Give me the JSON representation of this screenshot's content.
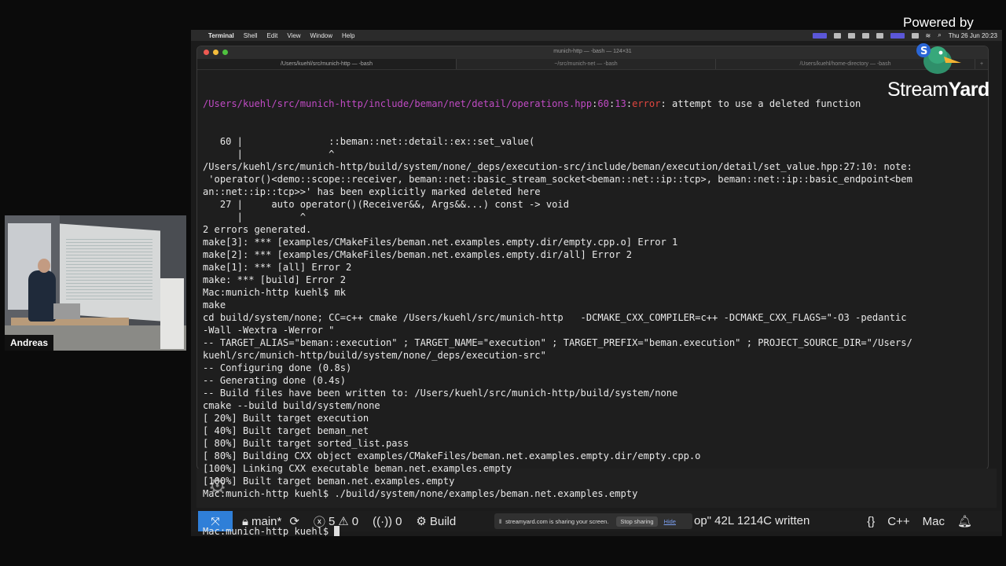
{
  "menubar": {
    "items": [
      "Terminal",
      "Shell",
      "Edit",
      "View",
      "Window",
      "Help"
    ],
    "datetime": "Thu 26 Jun  20:23"
  },
  "terminal": {
    "title": "munich-http — -bash — 124×31",
    "tabs": [
      "/Users/kuehl/src/munich-http — -bash",
      "~/src/munich-net — -bash",
      "/Users/kuehl/home-directory — -bash"
    ],
    "first_line": {
      "path": "/Users/kuehl/src/munich-http/include/beman/net/detail/operations.hpp",
      "line": "60",
      "col": "13",
      "kind": "error",
      "message": ": attempt to use a deleted function"
    },
    "lines": [
      "   60 |               ::beman::net::detail::ex::set_value(",
      "      |               ^",
      "/Users/kuehl/src/munich-http/build/system/none/_deps/execution-src/include/beman/execution/detail/set_value.hpp:27:10: note:",
      " 'operator()<demo::scope::receiver, beman::net::basic_stream_socket<beman::net::ip::tcp>, beman::net::ip::basic_endpoint<bem",
      "an::net::ip::tcp>>' has been explicitly marked deleted here",
      "   27 |     auto operator()(Receiver&&, Args&&...) const -> void",
      "      |          ^",
      "2 errors generated.",
      "make[3]: *** [examples/CMakeFiles/beman.net.examples.empty.dir/empty.cpp.o] Error 1",
      "make[2]: *** [examples/CMakeFiles/beman.net.examples.empty.dir/all] Error 2",
      "make[1]: *** [all] Error 2",
      "make: *** [build] Error 2",
      "Mac:munich-http kuehl$ mk",
      "make",
      "cd build/system/none; CC=c++ cmake /Users/kuehl/src/munich-http   -DCMAKE_CXX_COMPILER=c++ -DCMAKE_CXX_FLAGS=\"-O3 -pedantic",
      "-Wall -Wextra -Werror \"",
      "-- TARGET_ALIAS=\"beman::execution\" ; TARGET_NAME=\"execution\" ; TARGET_PREFIX=\"beman.execution\" ; PROJECT_SOURCE_DIR=\"/Users/",
      "kuehl/src/munich-http/build/system/none/_deps/execution-src\"",
      "-- Configuring done (0.8s)",
      "-- Generating done (0.4s)",
      "-- Build files have been written to: /Users/kuehl/src/munich-http/build/system/none",
      "cmake --build build/system/none",
      "[ 20%] Built target execution",
      "[ 40%] Built target beman_net",
      "[ 80%] Built target sorted_list.pass",
      "[ 80%] Building CXX object examples/CMakeFiles/beman.net.examples.empty.dir/empty.cpp.o",
      "[100%] Linking CXX executable beman.net.examples.empty",
      "[100%] Built target beman.net.examples.empty",
      "Mac:munich-http kuehl$ ./build/system/none/examples/beman.net.examples.empty"
    ],
    "prompt": "Mac:munich-http kuehl$ "
  },
  "statusbar": {
    "branch": "main*",
    "errors": "5",
    "warnings": "0",
    "ports": "0",
    "build": "Build",
    "written": "op\" 42L 1214C written",
    "lang": "C++",
    "platform": "Mac"
  },
  "sharebar": {
    "message": "streamyard.com is sharing your screen.",
    "stop": "Stop sharing",
    "hide": "Hide"
  },
  "webcam": {
    "name": "Andreas"
  },
  "branding": {
    "powered_by": "Powered by",
    "logo_a": "Stream",
    "logo_b": "Yard"
  },
  "colors": {
    "accent_blue": "#2f7fd8",
    "error_red": "#e0463f",
    "path_magenta": "#c04bc4"
  }
}
